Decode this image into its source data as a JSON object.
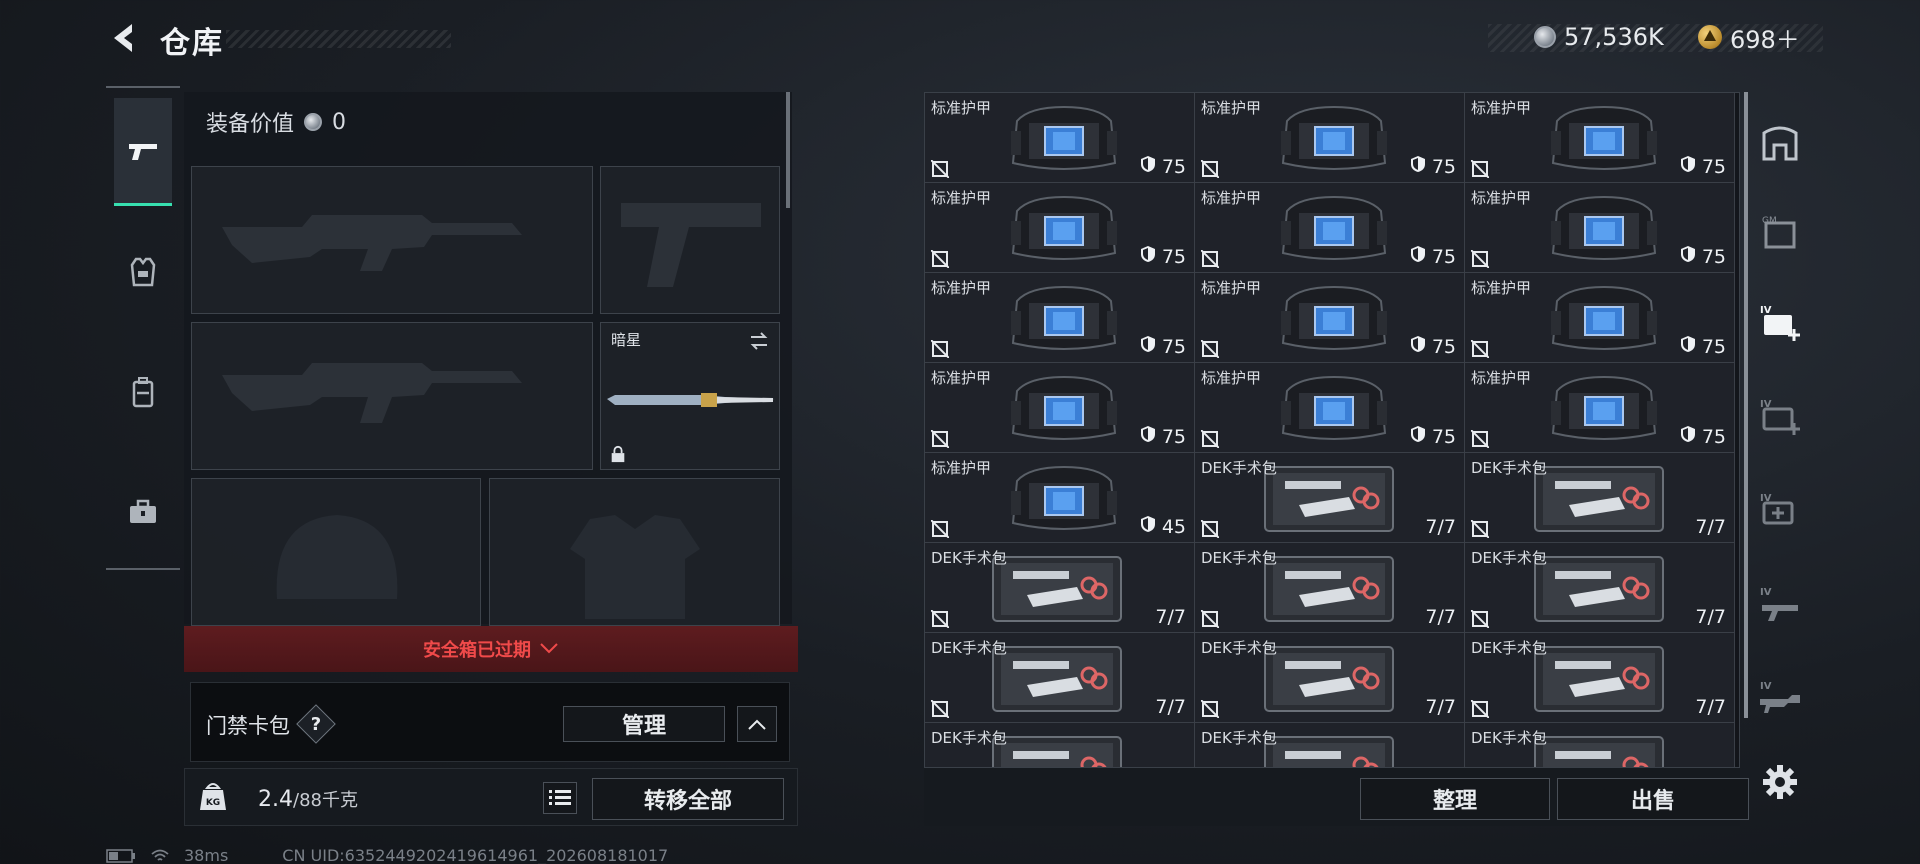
{
  "header": {
    "title": "仓库",
    "currency_silver": "57,536K",
    "currency_gold": "698＋"
  },
  "tabs": [
    {
      "name": "weapons",
      "icon": "pistol-icon",
      "active": true
    },
    {
      "name": "armor",
      "icon": "vest-icon",
      "active": false
    },
    {
      "name": "backpack",
      "icon": "backpack-icon",
      "active": false
    },
    {
      "name": "case",
      "icon": "toolbox-icon",
      "active": false
    }
  ],
  "equipment": {
    "value_label": "装备价值",
    "value": "0",
    "melee_name": "暗星",
    "safe_box_status": "安全箱已过期",
    "access_card_label": "门禁卡包",
    "help": "?",
    "manage_button": "管理",
    "weight_current": "2.4",
    "weight_max": "/88千克",
    "transfer_all_button": "转移全部"
  },
  "grid": {
    "items": [
      {
        "name": "标准护甲",
        "value": "75",
        "type": "armor"
      },
      {
        "name": "标准护甲",
        "value": "75",
        "type": "armor"
      },
      {
        "name": "标准护甲",
        "value": "75",
        "type": "armor"
      },
      {
        "name": "标准护甲",
        "value": "75",
        "type": "armor"
      },
      {
        "name": "标准护甲",
        "value": "75",
        "type": "armor"
      },
      {
        "name": "标准护甲",
        "value": "75",
        "type": "armor"
      },
      {
        "name": "标准护甲",
        "value": "75",
        "type": "armor"
      },
      {
        "name": "标准护甲",
        "value": "75",
        "type": "armor"
      },
      {
        "name": "标准护甲",
        "value": "75",
        "type": "armor"
      },
      {
        "name": "标准护甲",
        "value": "75",
        "type": "armor"
      },
      {
        "name": "标准护甲",
        "value": "75",
        "type": "armor"
      },
      {
        "name": "标准护甲",
        "value": "75",
        "type": "armor"
      },
      {
        "name": "标准护甲",
        "value": "45",
        "type": "armor"
      },
      {
        "name": "DEK手术包",
        "value": "7/7",
        "type": "medkit"
      },
      {
        "name": "DEK手术包",
        "value": "7/7",
        "type": "medkit"
      },
      {
        "name": "DEK手术包",
        "value": "7/7",
        "type": "medkit"
      },
      {
        "name": "DEK手术包",
        "value": "7/7",
        "type": "medkit"
      },
      {
        "name": "DEK手术包",
        "value": "7/7",
        "type": "medkit"
      },
      {
        "name": "DEK手术包",
        "value": "7/7",
        "type": "medkit"
      },
      {
        "name": "DEK手术包",
        "value": "7/7",
        "type": "medkit"
      },
      {
        "name": "DEK手术包",
        "value": "7/7",
        "type": "medkit"
      },
      {
        "name": "DEK手术包",
        "value": "",
        "type": "medkit"
      },
      {
        "name": "DEK手术包",
        "value": "",
        "type": "medkit"
      },
      {
        "name": "DEK手术包",
        "value": "",
        "type": "medkit"
      }
    ],
    "sort_button": "整理",
    "sell_button": "出售"
  },
  "categories": [
    {
      "icon": "all-items-icon"
    },
    {
      "icon": "gear-category-icon"
    },
    {
      "icon": "medical-iv-plus-icon"
    },
    {
      "icon": "medical-iv-icon"
    },
    {
      "icon": "medical-iv-2-icon"
    },
    {
      "icon": "weapon-iv-icon"
    },
    {
      "icon": "rifle-iv-icon"
    }
  ],
  "status": {
    "ping": "38ms",
    "uid": "CN UID:6352449202419614961_202608181017"
  },
  "colors": {
    "accent_green": "#37e0b0",
    "warning_red": "#f04a4a"
  }
}
